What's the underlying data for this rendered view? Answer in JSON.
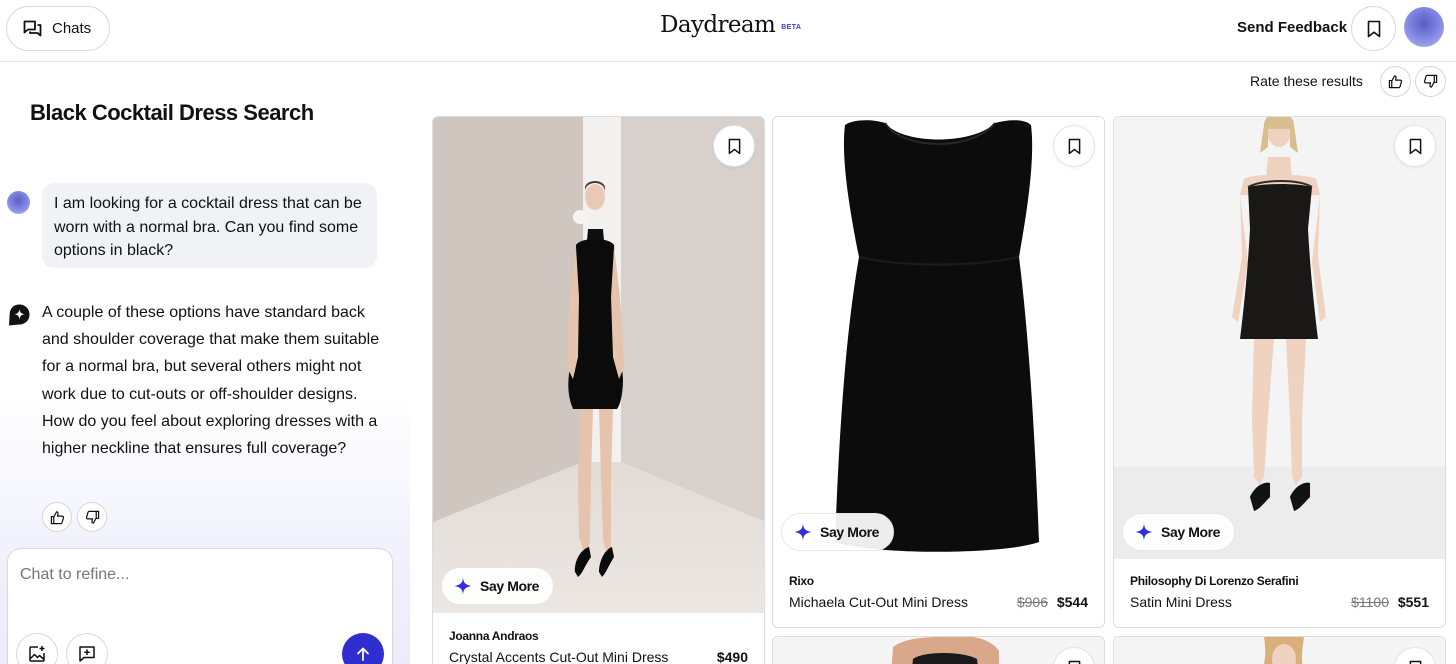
{
  "header": {
    "chats_label": "Chats",
    "logo": "Daydream",
    "beta": "BETA",
    "send_feedback": "Send Feedback"
  },
  "conversation": {
    "title": "Black Cocktail Dress Search",
    "user_message": "I am looking for a cocktail dress that can be worn with a normal bra. Can you find some options in black?",
    "assistant_message": "A couple of these options have standard back and shoulder coverage that make them suitable for a normal bra, but several others might not work due to cut-outs or off-shoulder designs. How do you feel about exploring dresses with a higher neckline that ensures full coverage?"
  },
  "chat_input": {
    "placeholder": "Chat to refine..."
  },
  "results": {
    "rate_label": "Rate these results",
    "say_more_label": "Say More",
    "products": [
      {
        "brand": "Joanna Andraos",
        "name": "Crystal Accents Cut-Out Mini Dress",
        "original_price": "",
        "price": "$490"
      },
      {
        "brand": "Rixo",
        "name": "Michaela Cut-Out Mini Dress",
        "original_price": "$906",
        "price": "$544"
      },
      {
        "brand": "Philosophy Di Lorenzo Serafini",
        "name": "Satin Mini Dress",
        "original_price": "$1100",
        "price": "$551"
      }
    ]
  },
  "colors": {
    "accent": "#2f2fd0",
    "star": "#3030d8"
  },
  "icons": [
    "chat-bubbles-icon",
    "bookmark-icon",
    "thumbs-up-icon",
    "thumbs-down-icon",
    "sparkle-icon",
    "image-add-icon",
    "message-add-icon",
    "arrow-up-icon"
  ]
}
